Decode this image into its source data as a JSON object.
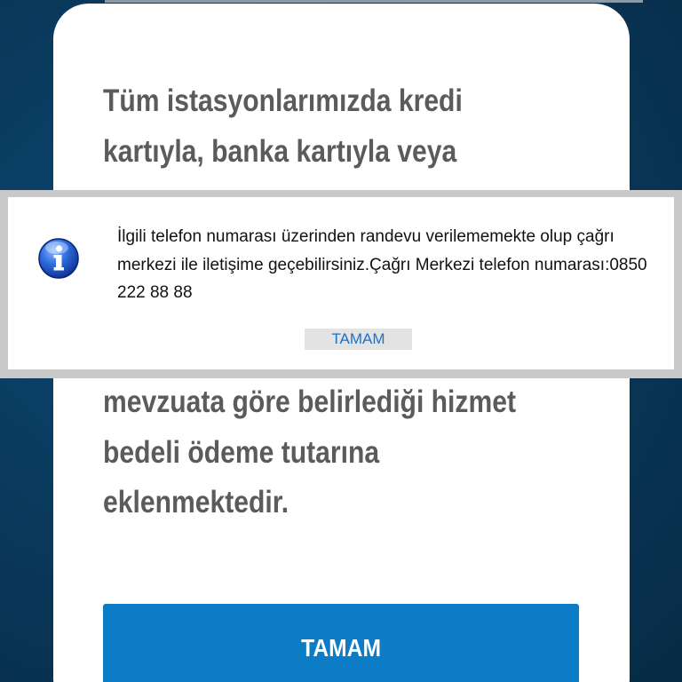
{
  "background_message": {
    "lines": [
      "Tüm istasyonlarımızda kredi",
      "kartıyla, banka kartıyla veya",
      "",
      "",
      "",
      "",
      "mevzuata göre belirlediği hizmet",
      "bedeli ödeme tutarına",
      "eklenmektedir."
    ]
  },
  "primary_button": {
    "label": "TAMAM"
  },
  "alert": {
    "icon": "info-icon",
    "message": "İlgili telefon numarası üzerinden randevu verilememekte olup çağrı merkezi ile iletişime geçebilirsiniz.Çağrı Merkezi telefon numarası:0850 222 88 88",
    "button_label": "TAMAM"
  },
  "colors": {
    "background": "#0a3a5e",
    "card": "#ffffff",
    "message_text": "#5b5b5b",
    "primary_button": "#0c7cc6",
    "alert_link": "#1a73c9"
  }
}
